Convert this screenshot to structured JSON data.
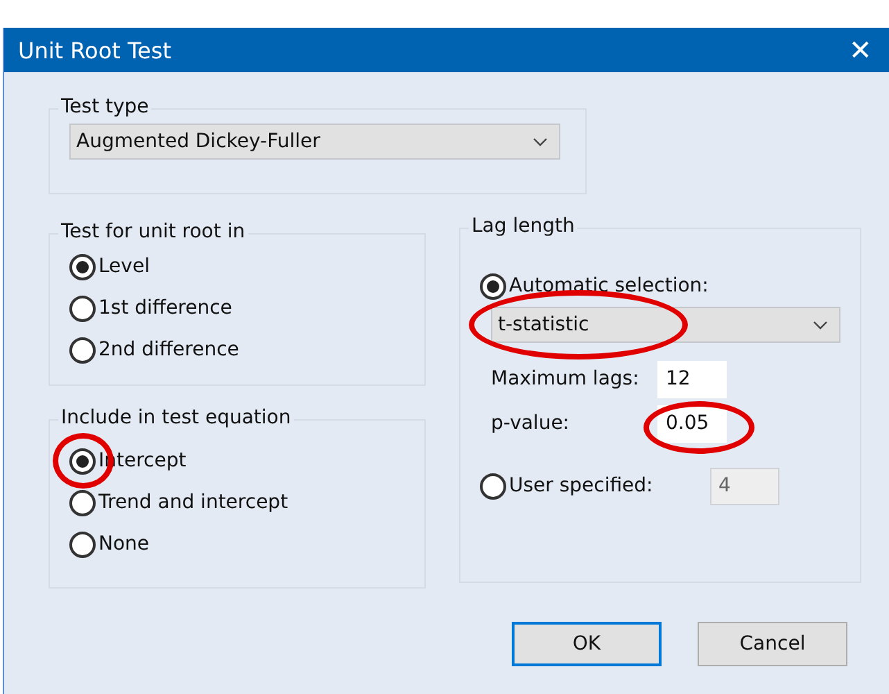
{
  "window": {
    "title": "Unit Root Test",
    "close": "✕"
  },
  "test_type": {
    "label": "Test type",
    "value": "Augmented Dickey-Fuller"
  },
  "unit_root_in": {
    "label": "Test for unit root in",
    "options": [
      {
        "label": "Level",
        "selected": true,
        "circled": false
      },
      {
        "label": "1st difference",
        "selected": false,
        "circled": false
      },
      {
        "label": "2nd difference",
        "selected": false,
        "circled": false
      }
    ]
  },
  "include": {
    "label": "Include in test equation",
    "options": [
      {
        "label": "Intercept",
        "selected": true,
        "circled": true
      },
      {
        "label": "Trend and intercept",
        "selected": false,
        "circled": false
      },
      {
        "label": "None",
        "selected": false,
        "circled": false
      }
    ]
  },
  "lag_length": {
    "label": "Lag length",
    "automatic": {
      "label": "Automatic selection:",
      "selected": true,
      "circled": false
    },
    "criterion": {
      "value": "t-statistic",
      "circled": true
    },
    "fields": [
      {
        "label": "Maximum lags:",
        "value": "12",
        "circled": false,
        "disabled": false
      },
      {
        "label": "p-value:",
        "value": "0.05",
        "circled": true,
        "disabled": false
      }
    ],
    "user": {
      "label": "User specified:",
      "selected": false,
      "circled": false,
      "value": "4",
      "disabled": true
    }
  },
  "buttons": [
    {
      "label": "OK",
      "default": true
    },
    {
      "label": "Cancel",
      "default": false
    }
  ]
}
